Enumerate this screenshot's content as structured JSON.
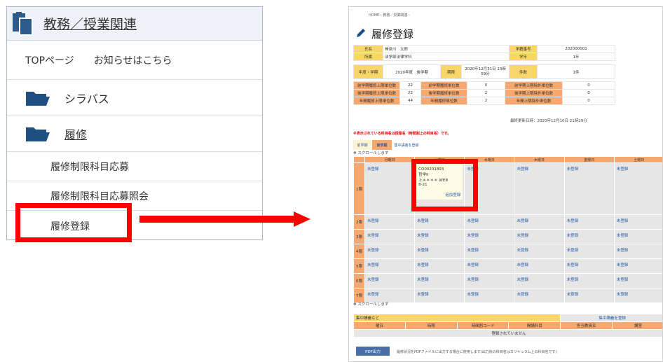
{
  "menu": {
    "title": "教務／授業関連",
    "top_link": "TOPページ",
    "notice_link": "お知らせはこちら",
    "syllabus": "シラバス",
    "rishu": "履修",
    "sub_items": [
      "履修制限科目応募",
      "履修制限科目応募照会",
      "履修登録"
    ]
  },
  "screen": {
    "breadcrumb": "HOME ›  教務／授業関連 ›",
    "title": "履修登録",
    "info": {
      "name_label": "氏名",
      "name": "神奈川　太郎",
      "id_label": "学籍番号",
      "id": "202000001",
      "dept_label": "所属",
      "dept": "法学部法律学科",
      "grade_label": "学年",
      "grade": "1年",
      "term_label": "年度・学期",
      "term": "2020年度　後学期",
      "deadline_label": "期限",
      "deadline": "2020年12月31日 23時59分",
      "count_label": "件数",
      "count": "1件"
    },
    "credits": [
      [
        "前学期履修上限単位数",
        "22",
        "前学期履修単位数",
        "0",
        "前学期上限除外単位数",
        "0"
      ],
      [
        "後学期履修上限単位数",
        "22",
        "後学期履修単位数",
        "2",
        "後学期上限除外単位数",
        "0"
      ],
      [
        "年間履修上限単位数",
        "44",
        "年間履修単位数",
        "2",
        "年間上限除外単位数",
        "0"
      ]
    ],
    "updated": "最終更新日時：2020年12月10日 21時29分",
    "notice": "※表示されている科目名は授業名（時間割上の科目名）です。",
    "tabs": [
      "前学期",
      "後学期",
      "集中講義を登録"
    ],
    "scroll_note": "スクロールします",
    "days": [
      "月曜日",
      "火曜日",
      "水曜日",
      "木曜日",
      "金曜日",
      "土曜日"
    ],
    "periods": [
      "1限",
      "2限",
      "3限",
      "4限",
      "5限",
      "6限",
      "7限"
    ],
    "unregistered": "未登録",
    "course": {
      "code": "CO00201893",
      "name": "哲学II",
      "teacher": "上＊＊＊＊ WEB",
      "room": "8-21",
      "add": "追加登録"
    },
    "intensive": {
      "title": "集中講義など",
      "register_link": "集中講義を登録",
      "headers": [
        "曜日",
        "時限",
        "時間割コード",
        "開講科目",
        "担当教員名",
        "講室"
      ],
      "empty": "登録されていません"
    },
    "pdf_button": "PDF出力",
    "pdf_note": "履修状況をPDFファイルに出力する場合に使用します(出力後の科目名はカリキュラム上の科目名です)"
  },
  "colors": {
    "highlight": "#ff0000",
    "orange": "#f6a86e",
    "yellow": "#f7d66a"
  }
}
